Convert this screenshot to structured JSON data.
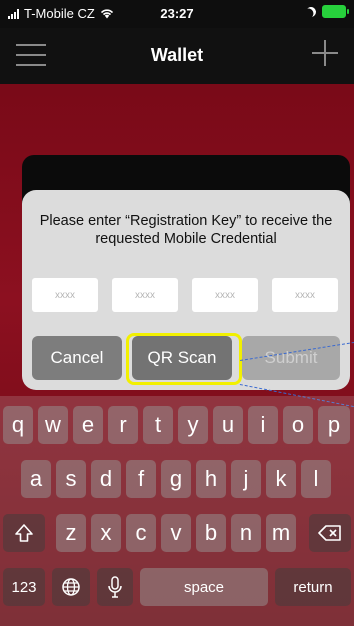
{
  "status_bar": {
    "carrier": "T-Mobile CZ",
    "time": "23:27",
    "icons": [
      "signal-icon",
      "wifi-icon",
      "moon-icon",
      "battery-icon"
    ]
  },
  "nav": {
    "title": "Wallet",
    "menu_icon": "hamburger-icon",
    "add_icon": "plus-icon"
  },
  "dialog": {
    "message": "Please enter “Registration Key” to receive the requested Mobile Credential",
    "fields": [
      {
        "placeholder": "xxxx",
        "value": ""
      },
      {
        "placeholder": "xxxx",
        "value": ""
      },
      {
        "placeholder": "xxxx",
        "value": ""
      },
      {
        "placeholder": "xxxx",
        "value": ""
      }
    ],
    "buttons": {
      "cancel": "Cancel",
      "qr_scan": "QR Scan",
      "submit": "Submit"
    }
  },
  "keyboard": {
    "row1": [
      "q",
      "w",
      "e",
      "r",
      "t",
      "y",
      "u",
      "i",
      "o",
      "p"
    ],
    "row2": [
      "a",
      "s",
      "d",
      "f",
      "g",
      "h",
      "j",
      "k",
      "l"
    ],
    "row3": [
      "z",
      "x",
      "c",
      "v",
      "b",
      "n",
      "m"
    ],
    "numbers_key": "123",
    "space_key": "space",
    "return_key": "return",
    "icons": [
      "shift-icon",
      "backspace-icon",
      "globe-icon",
      "microphone-icon"
    ]
  },
  "colors": {
    "highlight": "#f2f000",
    "battery": "#27d13c",
    "background": "#7a0a18"
  }
}
